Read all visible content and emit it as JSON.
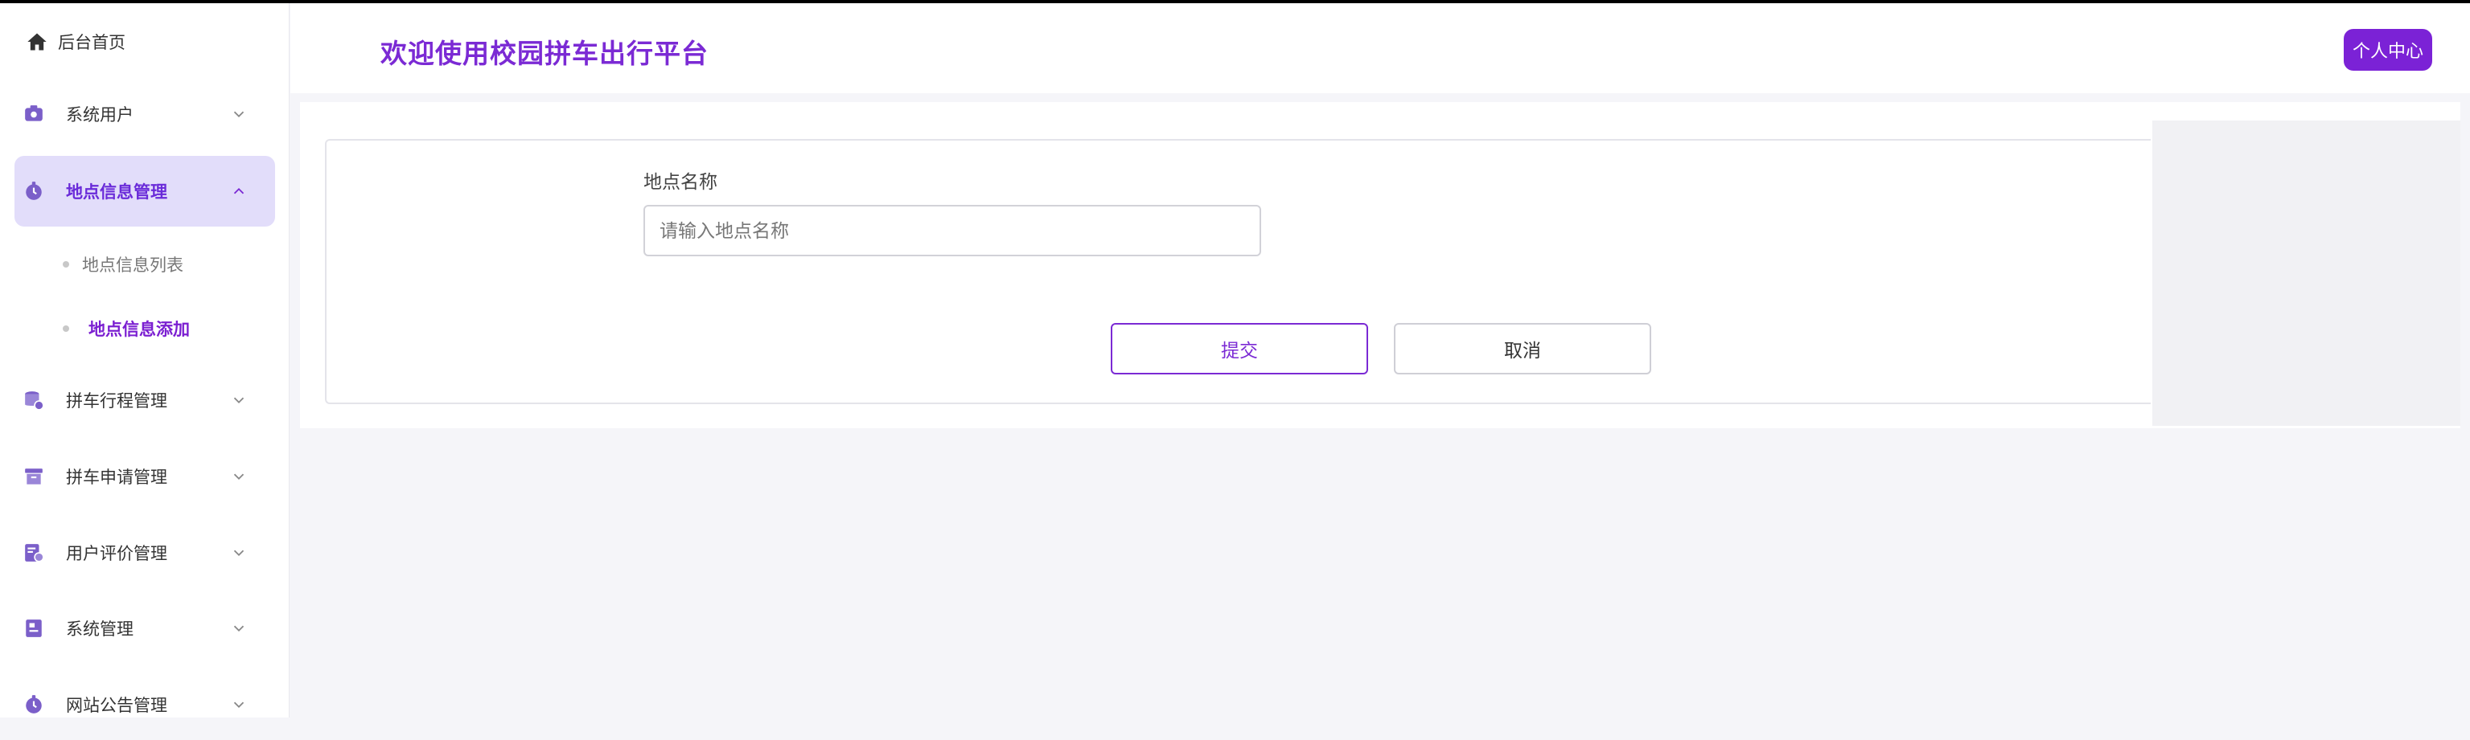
{
  "sidebar": {
    "home_label": "后台首页",
    "items": [
      {
        "label": "系统用户",
        "icon": "camera-icon"
      },
      {
        "label": "地点信息管理",
        "icon": "location-icon",
        "expanded": true
      },
      {
        "label": "拼车行程管理",
        "icon": "database-icon"
      },
      {
        "label": "拼车申请管理",
        "icon": "archive-icon"
      },
      {
        "label": "用户评价管理",
        "icon": "edit-icon"
      },
      {
        "label": "系统管理",
        "icon": "document-icon"
      },
      {
        "label": "网站公告管理",
        "icon": "bell-icon"
      }
    ],
    "subitems": [
      {
        "label": "地点信息列表"
      },
      {
        "label": "地点信息添加",
        "current": true
      }
    ]
  },
  "header": {
    "title": "欢迎使用校园拼车出行平台",
    "profile_label": "个人中心"
  },
  "form": {
    "field_label": "地点名称",
    "placeholder": "请输入地点名称",
    "value": "",
    "submit_label": "提交",
    "cancel_label": "取消"
  },
  "colors": {
    "accent": "#7b2ad4",
    "active_bg": "#e2ddfa",
    "icon": "#7b5fc9"
  }
}
